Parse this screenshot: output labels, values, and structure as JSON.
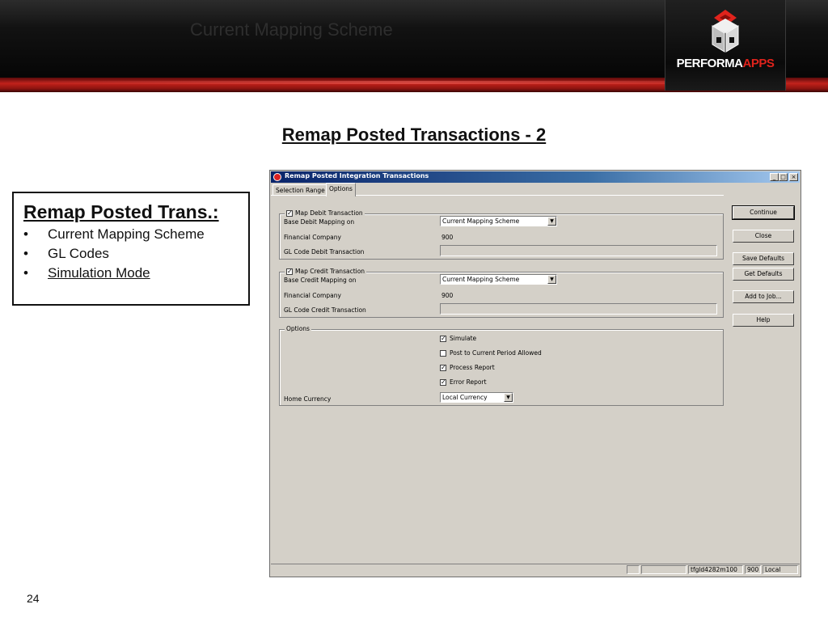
{
  "header": {
    "banner_title": "Current Mapping Scheme",
    "logo": {
      "brand_main": "PERFORMA",
      "brand_accent": "APPS"
    }
  },
  "slide": {
    "title": "Remap Posted Transactions - 2",
    "page_number": "24"
  },
  "bullet_box": {
    "heading": "Remap Posted Trans.:",
    "items": [
      "Current Mapping Scheme",
      "GL Codes",
      "Simulation Mode"
    ]
  },
  "dialog": {
    "title": "Remap Posted Integration Transactions",
    "window_controls": {
      "minimize": "_",
      "maximize": "□",
      "close": "×"
    },
    "tabs": [
      {
        "label": "Selection Range",
        "active": false
      },
      {
        "label": "Options",
        "active": true
      }
    ],
    "debit_group": {
      "legend": "Map Debit Transaction",
      "checked": true,
      "base_label": "Base Debit Mapping on",
      "base_value": "Current Mapping Scheme",
      "company_label": "Financial Company",
      "company_value": "900",
      "gl_label": "GL Code Debit Transaction",
      "gl_value": ""
    },
    "credit_group": {
      "legend": "Map Credit Transaction",
      "checked": true,
      "base_label": "Base Credit Mapping on",
      "base_value": "Current Mapping Scheme",
      "company_label": "Financial Company",
      "company_value": "900",
      "gl_label": "GL Code Credit Transaction",
      "gl_value": ""
    },
    "options_group": {
      "legend": "Options",
      "checkboxes": [
        {
          "label": "Simulate",
          "checked": true
        },
        {
          "label": "Post to Current Period Allowed",
          "checked": false
        },
        {
          "label": "Process Report",
          "checked": true
        },
        {
          "label": "Error Report",
          "checked": true
        }
      ],
      "home_currency_label": "Home Currency",
      "home_currency_value": "Local Currency"
    },
    "buttons": {
      "continue": "Continue",
      "close": "Close",
      "save_defaults": "Save Defaults",
      "get_defaults": "Get Defaults",
      "add_to_job": "Add to Job...",
      "help": "Help"
    },
    "status_bar": {
      "session": "tfgld4282m100",
      "company": "900",
      "mode": "Local"
    }
  }
}
